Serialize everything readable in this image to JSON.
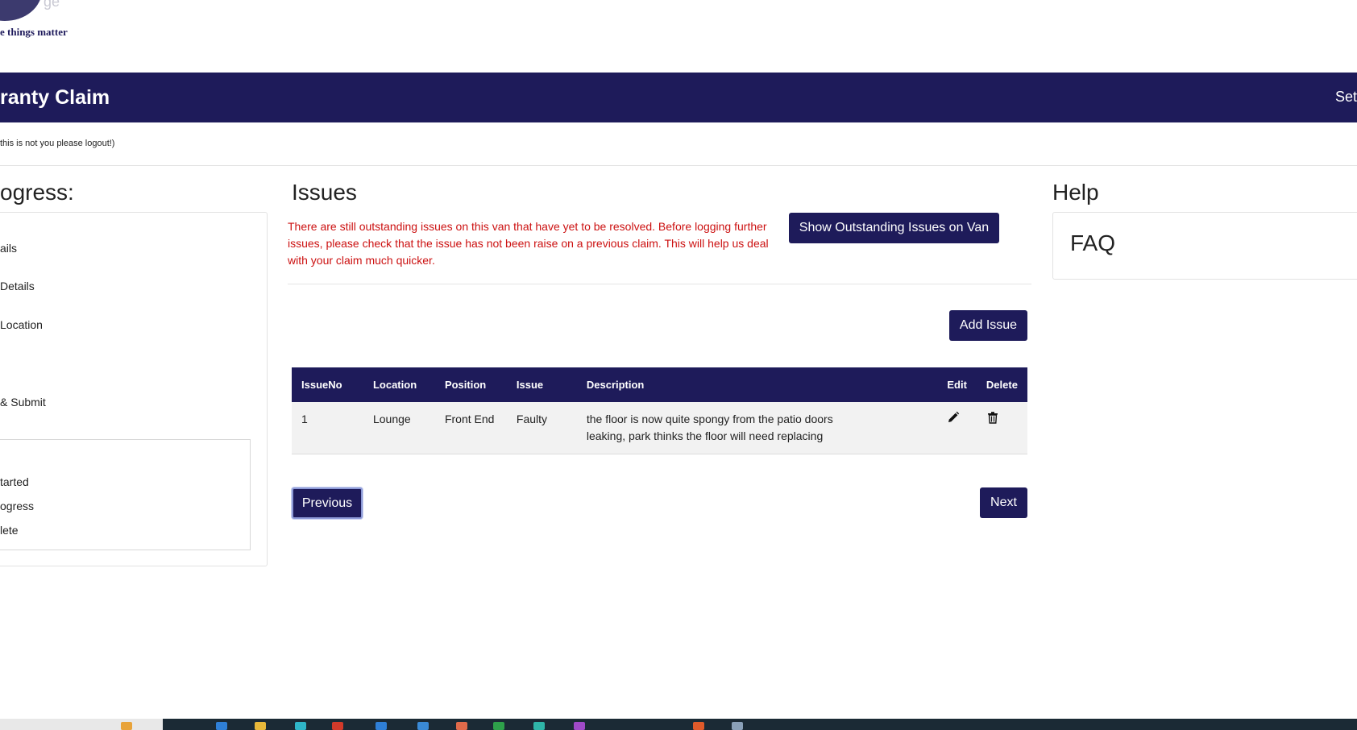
{
  "logo": {
    "ghost_text": "ge",
    "tagline": "e things matter"
  },
  "header": {
    "title": "ranty Claim",
    "right_link": "Set"
  },
  "user_note": "this is not you please logout!)",
  "progress": {
    "title": "ogress:",
    "steps": [
      "ails",
      "Details",
      "Location",
      "& Submit"
    ],
    "legend": [
      "tarted",
      "ogress",
      "lete"
    ]
  },
  "issues": {
    "title": "Issues",
    "warning": "There are still outstanding issues on this van that have yet to be resolved. Before logging further issues, please check that the issue has not been raise on a previous claim. This will help us deal with your claim much quicker.",
    "show_outstanding_label": "Show Outstanding Issues on Van",
    "add_issue_label": "Add Issue",
    "table": {
      "headers": [
        "IssueNo",
        "Location",
        "Position",
        "Issue",
        "Description",
        "Edit",
        "Delete"
      ],
      "rows": [
        {
          "issue_no": "1",
          "location": "Lounge",
          "position": "Front End",
          "issue": "Faulty",
          "description": "the floor is now quite spongy from the patio doors leaking, park thinks the floor will need replacing"
        }
      ]
    },
    "previous_label": "Previous",
    "next_label": "Next"
  },
  "help": {
    "title": "Help",
    "faq_title": "FAQ"
  },
  "colors": {
    "brand_navy": "#1e1b5a",
    "warning_red": "#cc1111"
  },
  "icons": {
    "edit": "pencil-icon",
    "delete": "trash-icon"
  }
}
